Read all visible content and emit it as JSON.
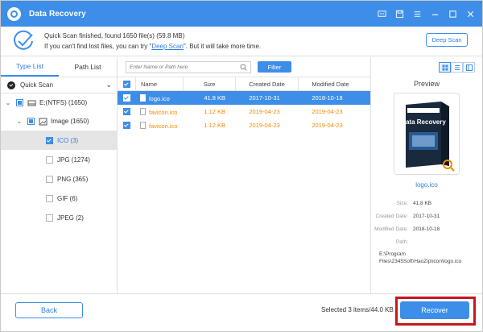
{
  "window": {
    "title": "Data Recovery",
    "accent": "#3d8ee8"
  },
  "status": {
    "line1": "Quick Scan finished, found 1650 file(s) (59.8 MB)",
    "line2_prefix": "If you can't find lost files, you can try \"",
    "line2_link": "Deep Scan",
    "line2_suffix": "\". But it will take more time.",
    "deep_scan_button": "Deep Scan"
  },
  "left": {
    "tabs": [
      "Type List",
      "Path List"
    ],
    "active_tab": "Type List",
    "quick_scan": "Quick Scan",
    "tree": [
      {
        "label": "E:(NTFS) (1650)"
      },
      {
        "label": "Image (1650)"
      },
      {
        "label": "ICO (3)"
      },
      {
        "label": "JPG (1274)"
      },
      {
        "label": "PNG (365)"
      },
      {
        "label": "GIF (6)"
      },
      {
        "label": "JPEG (2)"
      }
    ]
  },
  "center": {
    "search_placeholder": "Enter Name or Path here",
    "filter_button": "Filter",
    "columns": [
      "Name",
      "Size",
      "Created Date",
      "Modified Date"
    ],
    "rows": [
      {
        "name": "logo.ico",
        "size": "41.8 KB",
        "created": "2017-10-31",
        "modified": "2018-10-18"
      },
      {
        "name": "favicon.ico",
        "size": "1.12 KB",
        "created": "2019-04-23",
        "modified": "2019-04-23"
      },
      {
        "name": "favicon.ico",
        "size": "1.12 KB",
        "created": "2019-04-23",
        "modified": "2019-04-23"
      }
    ]
  },
  "right": {
    "preview_title": "Preview",
    "box_label": "Data Recovery",
    "preview_name": "logo.ico",
    "size_label": "Size:",
    "size_value": "41.8 KB",
    "created_label": "Created Date:",
    "created_value": "2017-10-31",
    "modified_label": "Modified Date:",
    "modified_value": "2018-10-18",
    "path_label": "Path:",
    "path_value": "E:\\Program Files\\2345Soft\\HaoZip\\icon\\logo.ico"
  },
  "footer": {
    "back_button": "Back",
    "selected_text": "Selected 3 items/44.0 KB",
    "recover_button": "Recover"
  }
}
